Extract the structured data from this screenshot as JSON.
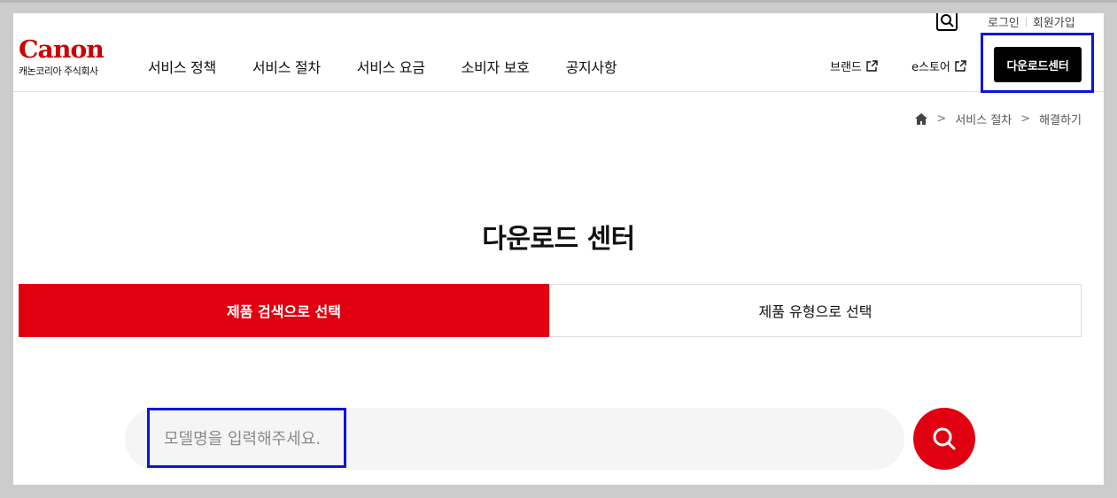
{
  "header": {
    "logo_text": "Canon",
    "logo_sub": "캐논코리아 주식회사",
    "nav": [
      "서비스 정책",
      "서비스 절차",
      "서비스 요금",
      "소비자 보호",
      "공지사항"
    ],
    "util": {
      "login": "로그인",
      "signup": "회원가입"
    },
    "ext_links": {
      "brand": "브랜드",
      "estore": "e스토어"
    },
    "download_button": "다운로드센터",
    "search_icon": "search-icon"
  },
  "breadcrumb": {
    "home_icon": "home-icon",
    "step1": "서비스 절차",
    "step2": "해결하기"
  },
  "main": {
    "title": "다운로드 센터",
    "tabs": [
      "제품 검색으로 선택",
      "제품 유형으로 선택"
    ],
    "search_placeholder": "모델명을 입력해주세요."
  },
  "colors": {
    "brand_red": "#e0000f",
    "highlight": "#0a14e0"
  }
}
